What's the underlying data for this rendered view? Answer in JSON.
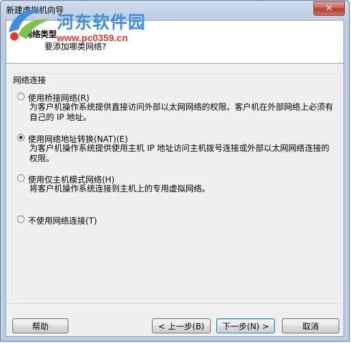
{
  "window": {
    "title": "新建虚拟机向导",
    "close_glyph": "✕"
  },
  "watermark": {
    "text": "河东软件园",
    "url": "www.pc0359.cn"
  },
  "header": {
    "title": "网络类型",
    "subtitle": "要添加哪类网络?"
  },
  "group": {
    "label": "网络连接",
    "options": [
      {
        "label": "使用桥接网络(R)",
        "checked": false,
        "description": "为客户机操作系统提供直接访问外部以太网网络的权限。客户机在外部网络上必须有自己的 IP 地址。"
      },
      {
        "label": "使用网络地址转换(NAT)(E)",
        "checked": true,
        "description": "为客户机操作系统提供使用主机 IP 地址访问主机拨号连接或外部以太网网络连接的权限。"
      },
      {
        "label": "使用仅主机模式网络(H)",
        "checked": false,
        "description": "将客户机操作系统连接到主机上的专用虚拟网络。"
      },
      {
        "label": "不使用网络连接(T)",
        "checked": false,
        "description": ""
      }
    ]
  },
  "buttons": {
    "help": "帮助",
    "back": "< 上一步(B)",
    "next": "下一步(N) >",
    "cancel": "取消"
  }
}
